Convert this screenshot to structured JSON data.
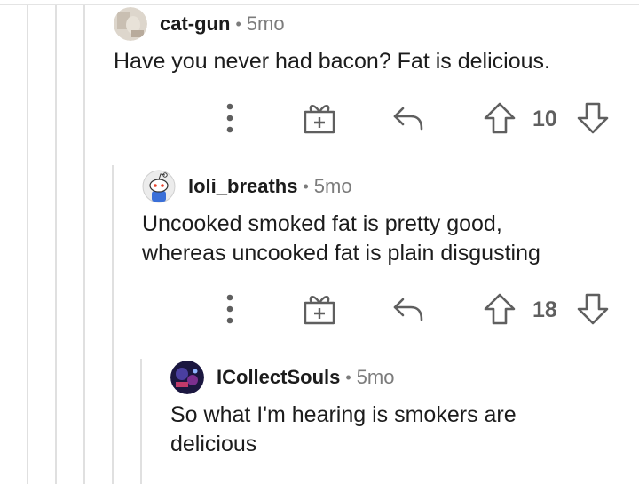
{
  "comments": [
    {
      "username": "cat-gun",
      "separator": "•",
      "age": "5mo",
      "text": "Have you never had bacon?  Fat is delicious.",
      "score": "10"
    },
    {
      "username": "loli_breaths",
      "separator": "•",
      "age": "5mo",
      "text": "Uncooked smoked fat is pretty good,\nwhereas uncooked fat is plain disgusting",
      "score": "18"
    },
    {
      "username": "ICollectSouls",
      "separator": "•",
      "age": "5mo",
      "text": "So what I'm hearing is smokers are\ndelicious"
    }
  ],
  "icons": {
    "more": "more-options-icon",
    "award": "gift-award-icon",
    "reply": "reply-arrow-icon",
    "upvote": "upvote-arrow-icon",
    "downvote": "downvote-arrow-icon"
  },
  "colors": {
    "icon": "#5f5f5f",
    "thread_line": "#e0e0e0",
    "meta_gray": "#7c7c7c"
  }
}
